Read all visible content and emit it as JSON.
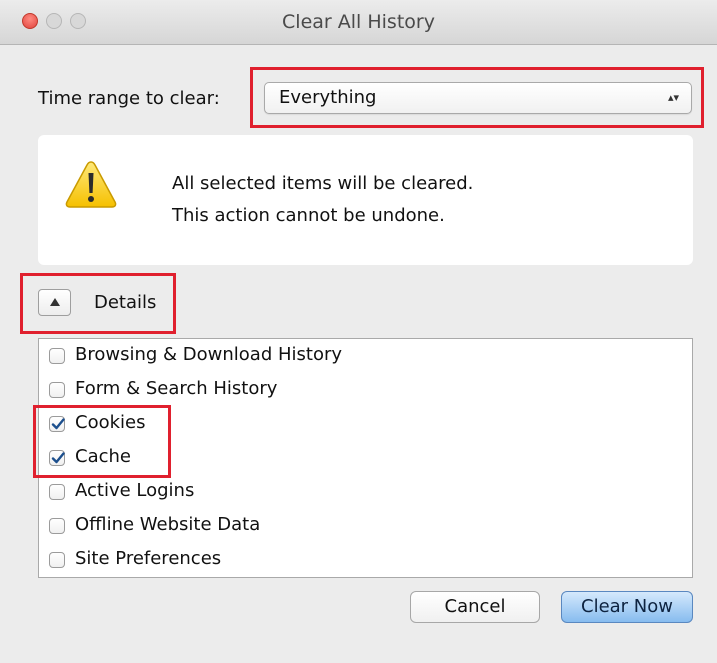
{
  "window": {
    "title": "Clear All History"
  },
  "time_range": {
    "label": "Time range to clear:",
    "selected": "Everything",
    "arrows": "▴▾"
  },
  "warning": {
    "icon": "warning-triangle-icon",
    "line1": "All selected items will be cleared.",
    "line2": "This action cannot be undone."
  },
  "details": {
    "label": "Details",
    "expanded": true
  },
  "items": [
    {
      "label": "Browsing & Download History",
      "checked": false
    },
    {
      "label": "Form & Search History",
      "checked": false
    },
    {
      "label": "Cookies",
      "checked": true
    },
    {
      "label": "Cache",
      "checked": true
    },
    {
      "label": "Active Logins",
      "checked": false
    },
    {
      "label": "Offline Website Data",
      "checked": false
    },
    {
      "label": "Site Preferences",
      "checked": false
    }
  ],
  "buttons": {
    "cancel": "Cancel",
    "clear_now": "Clear Now"
  },
  "colors": {
    "highlight": "#e0202e",
    "default_button": "#87bcef",
    "checkmark": "#1c4f8d"
  }
}
